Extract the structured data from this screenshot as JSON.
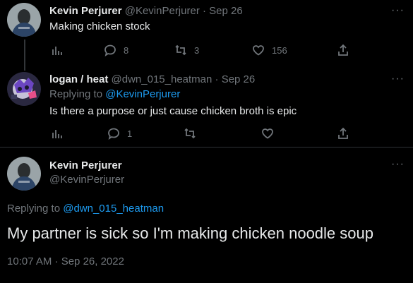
{
  "tweet1": {
    "name": "Kevin Perjurer",
    "handle": "@KevinPerjurer",
    "dot": "·",
    "date": "Sep 26",
    "text": "Making chicken stock",
    "replies": "8",
    "retweets": "3",
    "likes": "156"
  },
  "tweet2": {
    "name": "logan / heat",
    "handle": "@dwn_015_heatman",
    "dot": "·",
    "date": "Sep 26",
    "replying_prefix": "Replying to ",
    "replying_to": "@KevinPerjurer",
    "text": "Is there a purpose or just cause chicken broth is epic",
    "replies": "1",
    "retweets": "",
    "likes": ""
  },
  "main_tweet": {
    "name": "Kevin Perjurer",
    "handle": "@KevinPerjurer",
    "replying_prefix": "Replying to ",
    "replying_to": "@dwn_015_heatman",
    "text": "My partner is sick so I'm making chicken noodle soup",
    "timestamp": "10:07 AM · Sep 26, 2022"
  },
  "icons": {
    "more": "more-icon",
    "analytics": "analytics-icon",
    "reply": "reply-icon",
    "retweet": "retweet-icon",
    "like": "heart-icon",
    "share": "share-icon"
  },
  "colors": {
    "background": "#000000",
    "text": "#e7e9ea",
    "muted": "#71767b",
    "link": "#1d9bf0",
    "divider": "#2f3336"
  },
  "more_glyph": "···"
}
